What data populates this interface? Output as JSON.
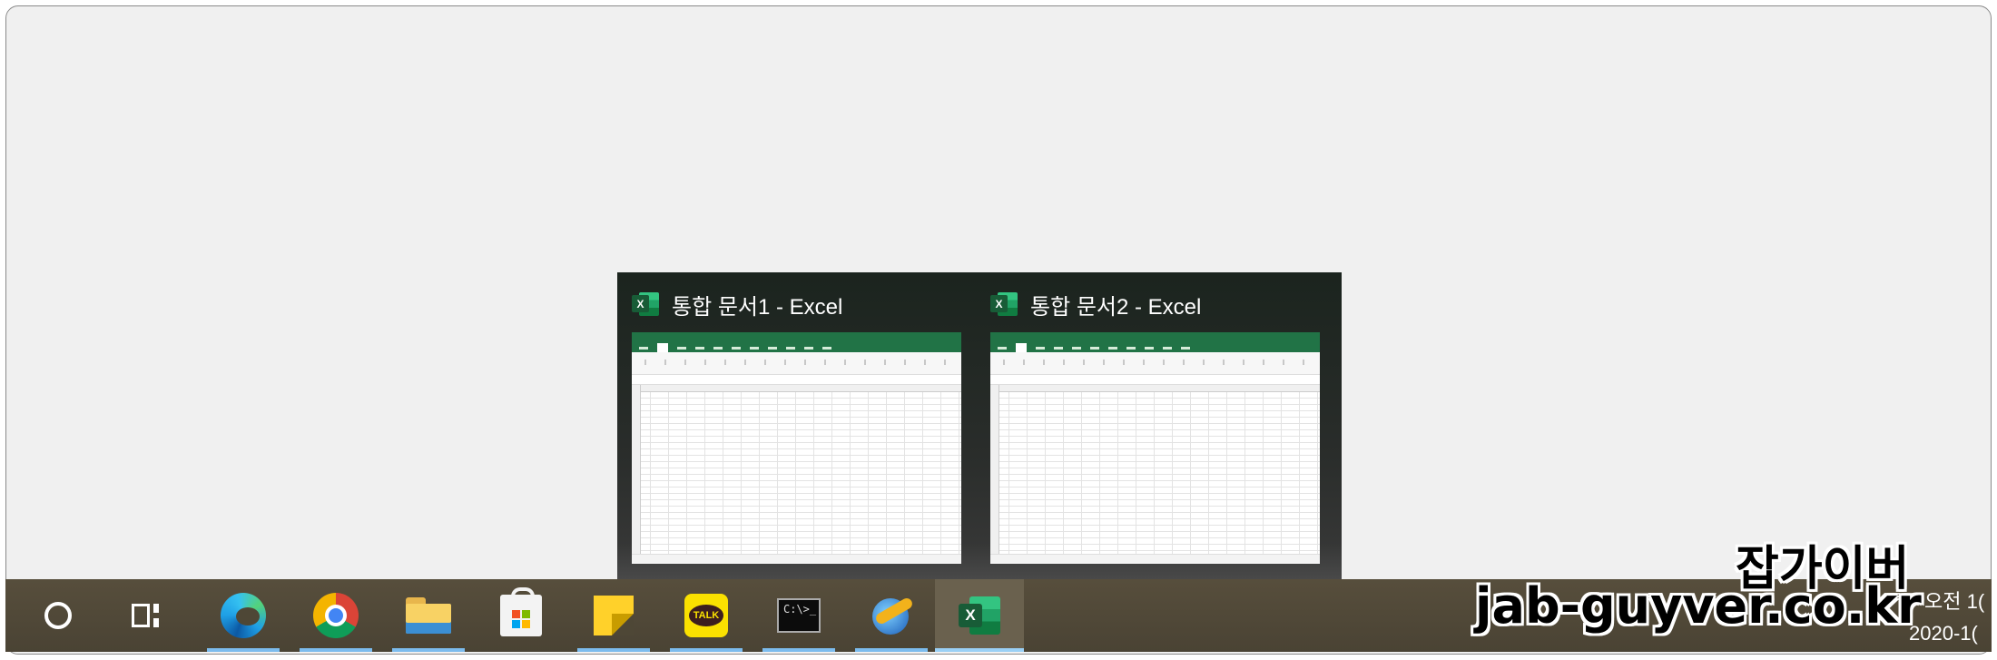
{
  "popup": {
    "thumbnails": [
      {
        "title": "통합 문서1 - Excel",
        "icon": "excel-icon",
        "icon_letter": "X"
      },
      {
        "title": "통합 문서2 - Excel",
        "icon": "excel-icon",
        "icon_letter": "X"
      }
    ]
  },
  "taskbar": {
    "buttons": [
      {
        "name": "cortana",
        "icon": "cortana-circle-icon",
        "running": false
      },
      {
        "name": "task-view",
        "icon": "task-view-icon",
        "running": false
      },
      {
        "name": "edge",
        "icon": "edge-icon",
        "running": true
      },
      {
        "name": "chrome",
        "icon": "chrome-icon",
        "running": true
      },
      {
        "name": "file-explorer",
        "icon": "folder-icon",
        "running": true
      },
      {
        "name": "microsoft-store",
        "icon": "store-bag-icon",
        "running": false
      },
      {
        "name": "sticky-notes",
        "icon": "sticky-note-icon",
        "running": true
      },
      {
        "name": "kakaotalk",
        "icon": "kakaotalk-icon",
        "label": "TALK",
        "running": true
      },
      {
        "name": "command-prompt",
        "icon": "terminal-icon",
        "label": "C:\\>_",
        "running": true
      },
      {
        "name": "app",
        "icon": "globe-swoosh-icon",
        "running": true
      },
      {
        "name": "excel",
        "icon": "excel-icon",
        "label": "X",
        "running": true,
        "active": true
      }
    ],
    "clock": {
      "time": "오전 1(",
      "date": "2020-1("
    }
  },
  "watermark": {
    "line1": "잡가이버",
    "line2": "jab-guyver.co.kr"
  },
  "colors": {
    "taskbar": "#524a3a",
    "running_indicator": "#7cbcee",
    "excel_green": "#217346",
    "desktop_bg": "#f0f0f0"
  }
}
